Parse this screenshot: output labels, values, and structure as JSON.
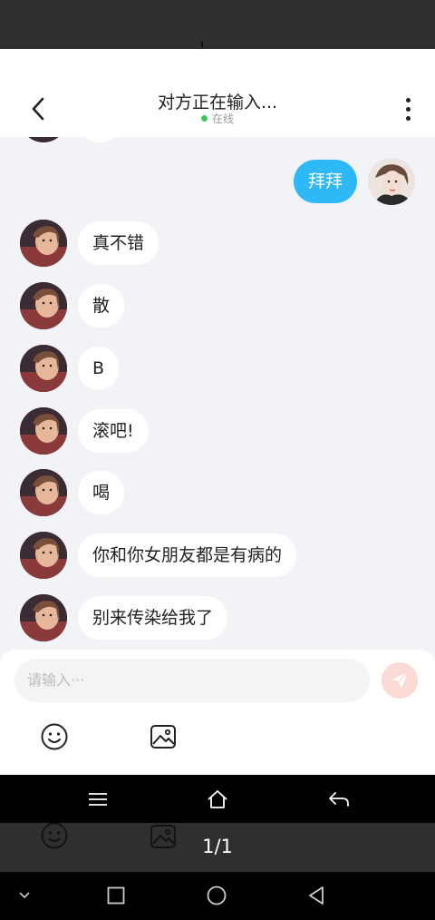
{
  "header": {
    "title": "对方正在输入...",
    "status": "在线"
  },
  "messages": [
    {
      "side": "me",
      "text": "拜拜"
    },
    {
      "side": "other",
      "text": "真不错"
    },
    {
      "side": "other",
      "text": "散"
    },
    {
      "side": "other",
      "text": "B"
    },
    {
      "side": "other",
      "text": "滚吧!"
    },
    {
      "side": "other",
      "text": "喝"
    },
    {
      "side": "other",
      "text": "你和你女朋友都是有病的"
    },
    {
      "side": "other",
      "text": "别来传染给我了"
    }
  ],
  "composer": {
    "placeholder": "请输入···"
  },
  "viewer": {
    "page_indicator": "1/1"
  },
  "colors": {
    "my_bubble": "#2fb8f6",
    "online_dot": "#3bc85b",
    "send_button": "#fbd9d5"
  },
  "icons": [
    "back-arrow-icon",
    "more-vertical-icon",
    "send-icon",
    "emoji-icon",
    "image-icon",
    "menu-icon",
    "home-icon",
    "return-icon",
    "chevron-down-icon",
    "recent-apps-icon",
    "home-circle-icon",
    "back-triangle-icon"
  ]
}
